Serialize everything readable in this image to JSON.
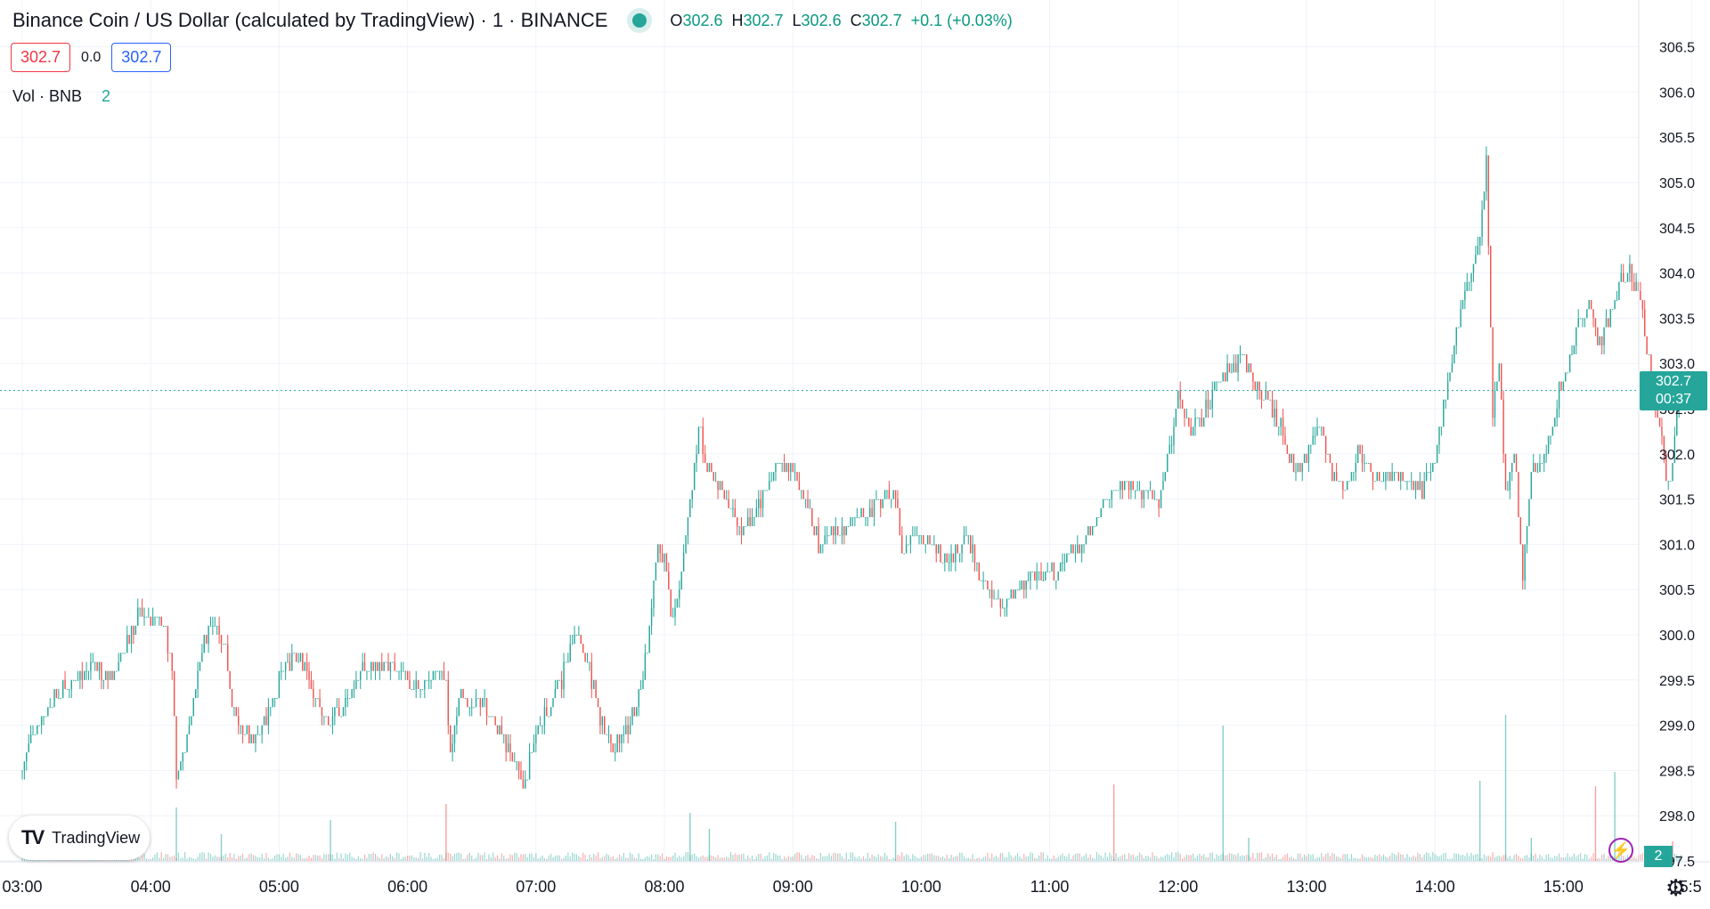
{
  "legend": {
    "title": "Binance Coin / US Dollar (calculated by TradingView) · 1 · BINANCE",
    "open_label": "O",
    "open": "302.6",
    "high_label": "H",
    "high": "302.7",
    "low_label": "L",
    "low": "302.6",
    "close_label": "C",
    "close": "302.7",
    "change": "+0.1 (+0.03%)"
  },
  "trade": {
    "sell": "302.7",
    "spread": "0.0",
    "buy": "302.7"
  },
  "volume": {
    "label": "Vol · BNB",
    "value": "2"
  },
  "price_tag": {
    "price": "302.7",
    "countdown": "00:37"
  },
  "branding": {
    "logo_text": "TradingView"
  },
  "colors": {
    "up": "#26a69a",
    "down": "#ef5350",
    "grid": "#f0f3fa",
    "axis_text": "#131722"
  },
  "chart_data": {
    "type": "candlestick",
    "timeframe": "1",
    "title": "Binance Coin / US Dollar (calculated by TradingView)",
    "x_ticks": [
      "03:00",
      "04:00",
      "05:00",
      "06:00",
      "07:00",
      "08:00",
      "09:00",
      "10:00",
      "11:00",
      "12:00",
      "13:00",
      "14:00",
      "15:00",
      "15:5"
    ],
    "y_ticks": [
      306.5,
      306.0,
      305.5,
      305.0,
      304.5,
      304.0,
      303.5,
      303.0,
      302.5,
      302.0,
      301.5,
      301.0,
      300.5,
      300.0,
      299.5,
      299.0,
      298.5,
      298.0,
      297.5
    ],
    "ylim": [
      297.4,
      306.75
    ],
    "x_range_hours": [
      3.0,
      15.92
    ],
    "last_price": 302.7,
    "grid": true,
    "close_series": [
      [
        3.0,
        298.5
      ],
      [
        3.1,
        299.0
      ],
      [
        3.25,
        299.3
      ],
      [
        3.4,
        299.5
      ],
      [
        3.55,
        299.7
      ],
      [
        3.7,
        299.5
      ],
      [
        3.8,
        299.9
      ],
      [
        3.9,
        300.2
      ],
      [
        4.0,
        300.2
      ],
      [
        4.1,
        300.1
      ],
      [
        4.17,
        299.6
      ],
      [
        4.2,
        298.4
      ],
      [
        4.28,
        298.8
      ],
      [
        4.4,
        299.9
      ],
      [
        4.5,
        300.2
      ],
      [
        4.58,
        299.9
      ],
      [
        4.62,
        299.3
      ],
      [
        4.7,
        299.0
      ],
      [
        4.78,
        298.8
      ],
      [
        4.9,
        299.1
      ],
      [
        5.0,
        299.5
      ],
      [
        5.1,
        299.7
      ],
      [
        5.2,
        299.7
      ],
      [
        5.3,
        299.2
      ],
      [
        5.4,
        299.0
      ],
      [
        5.5,
        299.2
      ],
      [
        5.6,
        299.5
      ],
      [
        5.75,
        299.7
      ],
      [
        5.9,
        299.6
      ],
      [
        6.0,
        299.5
      ],
      [
        6.1,
        299.4
      ],
      [
        6.2,
        299.6
      ],
      [
        6.3,
        299.5
      ],
      [
        6.33,
        298.6
      ],
      [
        6.4,
        299.3
      ],
      [
        6.5,
        299.3
      ],
      [
        6.6,
        299.2
      ],
      [
        6.7,
        299.0
      ],
      [
        6.8,
        298.7
      ],
      [
        6.9,
        298.3
      ],
      [
        7.0,
        298.9
      ],
      [
        7.1,
        299.2
      ],
      [
        7.2,
        299.5
      ],
      [
        7.3,
        300.0
      ],
      [
        7.4,
        299.7
      ],
      [
        7.5,
        299.1
      ],
      [
        7.6,
        298.8
      ],
      [
        7.7,
        298.9
      ],
      [
        7.8,
        299.3
      ],
      [
        7.88,
        300.0
      ],
      [
        7.95,
        301.0
      ],
      [
        8.0,
        300.8
      ],
      [
        8.05,
        300.2
      ],
      [
        8.12,
        300.5
      ],
      [
        8.2,
        301.5
      ],
      [
        8.27,
        302.3
      ],
      [
        8.33,
        301.8
      ],
      [
        8.4,
        301.7
      ],
      [
        8.5,
        301.5
      ],
      [
        8.6,
        301.1
      ],
      [
        8.7,
        301.3
      ],
      [
        8.8,
        301.6
      ],
      [
        8.9,
        301.9
      ],
      [
        9.0,
        301.8
      ],
      [
        9.1,
        301.5
      ],
      [
        9.2,
        301.0
      ],
      [
        9.3,
        301.1
      ],
      [
        9.4,
        301.2
      ],
      [
        9.5,
        301.3
      ],
      [
        9.6,
        301.4
      ],
      [
        9.7,
        301.5
      ],
      [
        9.8,
        301.6
      ],
      [
        9.85,
        300.9
      ],
      [
        9.95,
        301.2
      ],
      [
        10.05,
        301.0
      ],
      [
        10.15,
        300.9
      ],
      [
        10.25,
        300.9
      ],
      [
        10.35,
        301.1
      ],
      [
        10.45,
        300.7
      ],
      [
        10.55,
        300.4
      ],
      [
        10.65,
        300.3
      ],
      [
        10.75,
        300.5
      ],
      [
        10.85,
        300.6
      ],
      [
        10.95,
        300.7
      ],
      [
        11.05,
        300.7
      ],
      [
        11.15,
        300.9
      ],
      [
        11.25,
        301.0
      ],
      [
        11.35,
        301.3
      ],
      [
        11.45,
        301.5
      ],
      [
        11.55,
        301.7
      ],
      [
        11.65,
        301.6
      ],
      [
        11.75,
        301.6
      ],
      [
        11.85,
        301.4
      ],
      [
        11.92,
        302.0
      ],
      [
        12.0,
        302.6
      ],
      [
        12.1,
        302.3
      ],
      [
        12.2,
        302.4
      ],
      [
        12.3,
        302.8
      ],
      [
        12.4,
        302.9
      ],
      [
        12.5,
        303.1
      ],
      [
        12.6,
        302.8
      ],
      [
        12.7,
        302.6
      ],
      [
        12.8,
        302.3
      ],
      [
        12.9,
        301.8
      ],
      [
        13.0,
        302.0
      ],
      [
        13.1,
        302.4
      ],
      [
        13.2,
        301.8
      ],
      [
        13.3,
        301.6
      ],
      [
        13.4,
        302.0
      ],
      [
        13.5,
        301.8
      ],
      [
        13.6,
        301.7
      ],
      [
        13.7,
        301.8
      ],
      [
        13.8,
        301.7
      ],
      [
        13.9,
        301.6
      ],
      [
        14.0,
        301.9
      ],
      [
        14.1,
        302.8
      ],
      [
        14.2,
        303.6
      ],
      [
        14.3,
        304.1
      ],
      [
        14.35,
        304.4
      ],
      [
        14.4,
        305.2
      ],
      [
        14.45,
        302.4
      ],
      [
        14.5,
        303.0
      ],
      [
        14.55,
        301.6
      ],
      [
        14.62,
        302.1
      ],
      [
        14.68,
        300.6
      ],
      [
        14.75,
        301.8
      ],
      [
        14.85,
        301.9
      ],
      [
        14.95,
        302.6
      ],
      [
        15.05,
        303.0
      ],
      [
        15.12,
        303.5
      ],
      [
        15.2,
        303.7
      ],
      [
        15.28,
        303.2
      ],
      [
        15.38,
        303.6
      ],
      [
        15.45,
        303.9
      ],
      [
        15.52,
        304.0
      ],
      [
        15.6,
        303.7
      ],
      [
        15.68,
        302.9
      ],
      [
        15.75,
        302.3
      ],
      [
        15.8,
        301.8
      ],
      [
        15.83,
        301.7
      ],
      [
        15.88,
        302.5
      ],
      [
        15.92,
        302.7
      ]
    ],
    "volume_axis": {
      "max": 12
    },
    "volume_spikes": [
      [
        4.2,
        3
      ],
      [
        4.55,
        1.5
      ],
      [
        5.4,
        2.3
      ],
      [
        6.3,
        3.2
      ],
      [
        8.2,
        2.7
      ],
      [
        8.35,
        1.8
      ],
      [
        9.8,
        2.2
      ],
      [
        11.5,
        4.3
      ],
      [
        12.35,
        7.6
      ],
      [
        12.55,
        1.3
      ],
      [
        14.35,
        4.5
      ],
      [
        14.55,
        8.2
      ],
      [
        14.75,
        1.3
      ],
      [
        15.25,
        4.2
      ],
      [
        15.4,
        5.0
      ],
      [
        15.85,
        1.1
      ]
    ]
  }
}
